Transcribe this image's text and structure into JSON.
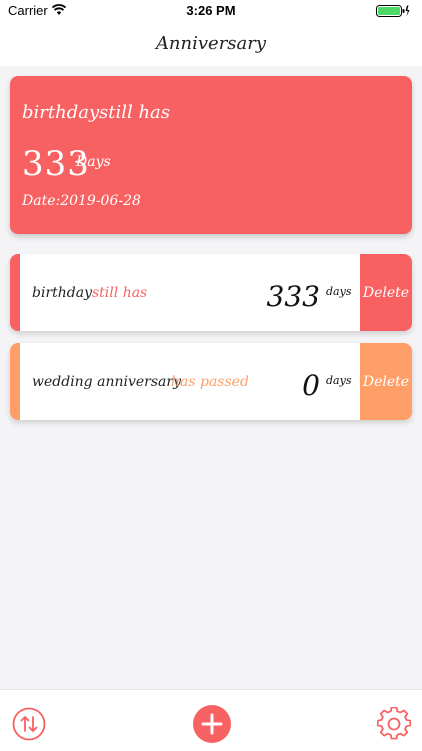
{
  "status_bar": {
    "carrier": "Carrier",
    "time": "3:26 PM"
  },
  "nav": {
    "title": "Anniversary"
  },
  "hero": {
    "event": "birthday",
    "status": "still has",
    "count": "333",
    "unit": "Days",
    "date": "Date:2019-06-28"
  },
  "rows": [
    {
      "name": "birthday",
      "status": "still has",
      "count": "333",
      "unit": "days",
      "delete_label": "Delete"
    },
    {
      "name": "wedding anniversary",
      "status": "has passed",
      "count": "0",
      "unit": "days",
      "delete_label": "Delete"
    }
  ],
  "colors": {
    "accent_red": "#f86161",
    "accent_orange": "#ff9e66"
  },
  "tab_bar": {
    "icons": [
      "sort-icon",
      "add-icon",
      "gear-icon"
    ]
  }
}
